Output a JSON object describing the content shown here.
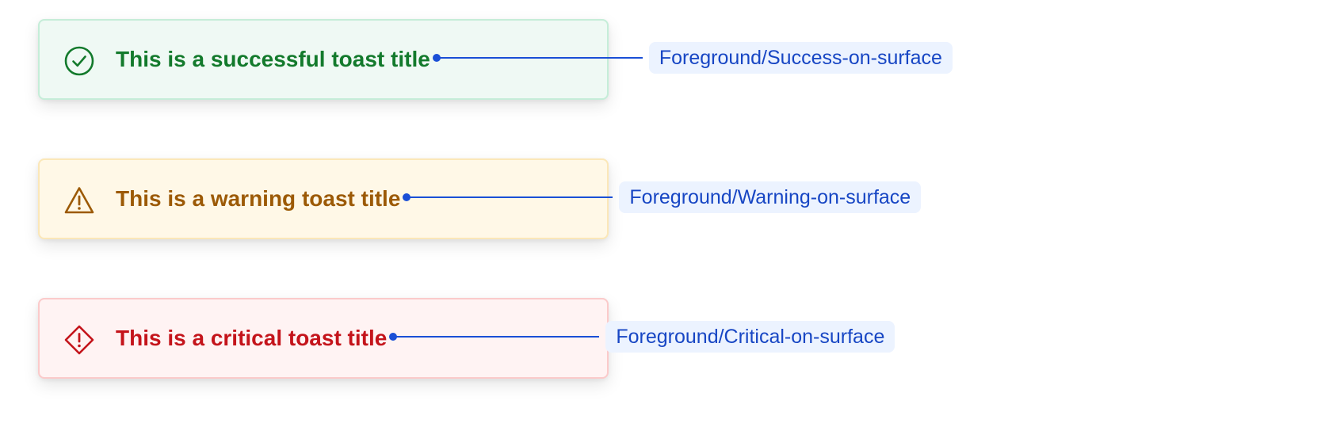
{
  "toasts": [
    {
      "variant": "success",
      "icon": "check-circle-icon",
      "title": "This is a successful toast title",
      "annotation": "Foreground/Success-on-surface",
      "text_color": "#137a2c",
      "background": "#eff9f4",
      "border": "#c5edd8"
    },
    {
      "variant": "warning",
      "icon": "warning-triangle-icon",
      "title": "This is a warning toast title",
      "annotation": "Foreground/Warning-on-surface",
      "text_color": "#9c5a06",
      "background": "#fff8e7",
      "border": "#fbe7b8"
    },
    {
      "variant": "critical",
      "icon": "critical-diamond-icon",
      "title": "This is a critical toast title",
      "annotation": "Foreground/Critical-on-surface",
      "text_color": "#c4141b",
      "background": "#fff3f3",
      "border": "#fbcaca"
    }
  ],
  "annotation_style": {
    "color": "#1a4fd6",
    "label_background": "#ecf3ff"
  }
}
